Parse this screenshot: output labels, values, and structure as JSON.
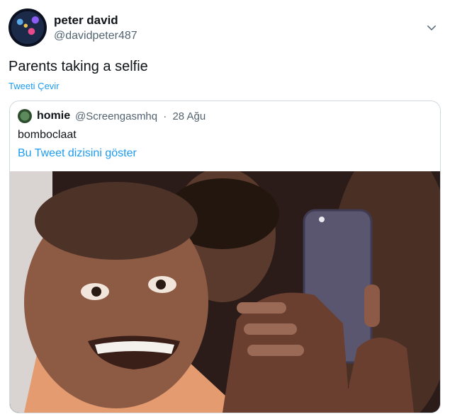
{
  "tweet": {
    "author_name": "peter david",
    "author_handle": "@davidpeter487",
    "text": "Parents taking a selfie",
    "translate_label": "Tweeti Çevir"
  },
  "quoted_tweet": {
    "author_name": "homie",
    "author_handle": "@Screengasmhq",
    "separator": "·",
    "date": "28 Ağu",
    "text": "bomboclaat",
    "thread_link": "Bu Tweet dizisini göster"
  },
  "icons": {
    "more": "chevron-down-icon"
  },
  "colors": {
    "link": "#1d9bf0",
    "secondary_text": "#536471",
    "border": "#cfd9de"
  }
}
